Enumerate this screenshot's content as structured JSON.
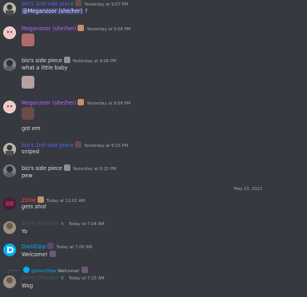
{
  "colors": {
    "background": "#36393f",
    "purple_name": "#b266ff",
    "blue_name": "#5865f2",
    "gray_name": "#8e9297",
    "red_name": "#ff4444",
    "cyan_name": "#00aff4",
    "text": "#dcddde",
    "timestamp": "#a3a6aa"
  },
  "messages": [
    {
      "user": "bio's 2nd side piece",
      "ts": "Yesterday at 9:07 PM",
      "mention": "@Meganzoor (she/her)",
      "text": " ?"
    },
    {
      "user": "Meganzoor (she/her)",
      "ts": "Yesterday at 9:08 PM"
    },
    {
      "user": "bio's side piece",
      "ts": "Yesterday at 9:08 PM",
      "text": "what a little baby"
    },
    {
      "user": "Meganzoor (she/her)",
      "ts": "Yesterday at 9:09 PM",
      "text": "got em"
    },
    {
      "user": "bio's 2nd side piece",
      "ts": "Yesterday at 9:15 PM",
      "text": "sniped"
    },
    {
      "user": "bio's side piece",
      "ts": "Yesterday at 9:15 PM",
      "text": "pew"
    },
    {
      "user": "Zellie",
      "ts": "Today at 12:02 AM",
      "text": "gets shot"
    },
    {
      "user": "Binny Mackee",
      "ts": "Today at 7:04 AM",
      "text": "Yo"
    },
    {
      "user": "DaniDipp",
      "ts": "Today at 7:06 AM",
      "text": "Welcome!"
    },
    {
      "user": "Binny Mackee",
      "ts": "Today at 7:25 AM",
      "text": "Wsg"
    }
  ],
  "date_separator": "May 23, 2022",
  "reply": {
    "user": "@DaniDipp",
    "text": "Welcome!"
  }
}
